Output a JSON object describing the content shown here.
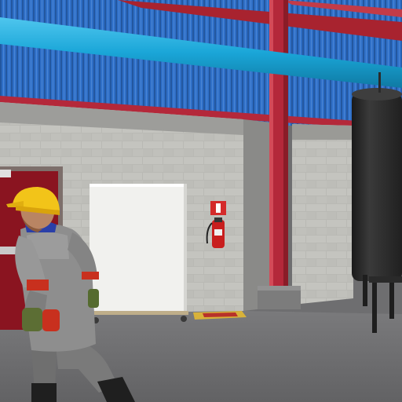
{
  "scene": {
    "fire_sign_label": "",
    "colors": {
      "wall_blue": "#2f6fc7",
      "steel_red": "#b4283a",
      "pipe_cyan": "#1aa6d8",
      "door_red": "#8a1420",
      "block_wall": "#b9b9b4",
      "floor": "#6b6b6d",
      "tank": "#262626",
      "hardhat": "#f2c419",
      "coverall": "#8e8e8e"
    }
  }
}
